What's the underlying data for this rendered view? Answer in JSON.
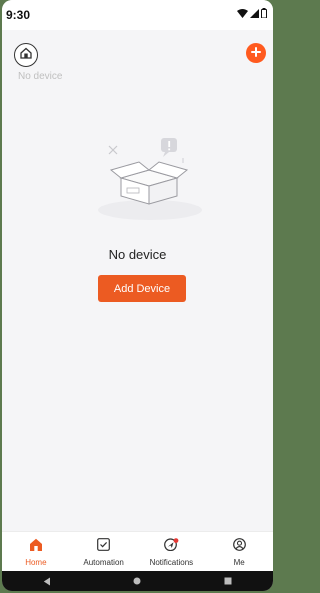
{
  "status": {
    "time": "9:30"
  },
  "header": {
    "subtitle": "No device"
  },
  "empty_state": {
    "title": "No device",
    "button_label": "Add Device"
  },
  "tabs": [
    {
      "label": "Home",
      "active": true
    },
    {
      "label": "Automation",
      "active": false
    },
    {
      "label": "Notifications",
      "active": false
    },
    {
      "label": "Me",
      "active": false
    }
  ],
  "colors": {
    "accent": "#ec5b22",
    "background": "#f5f5f7"
  },
  "icons": [
    "wifi-icon",
    "signal-icon",
    "battery-icon",
    "home-icon",
    "plus-icon",
    "empty-box-icon",
    "automation-icon",
    "notifications-icon",
    "me-icon",
    "back-icon",
    "home-nav-icon",
    "recents-icon"
  ]
}
